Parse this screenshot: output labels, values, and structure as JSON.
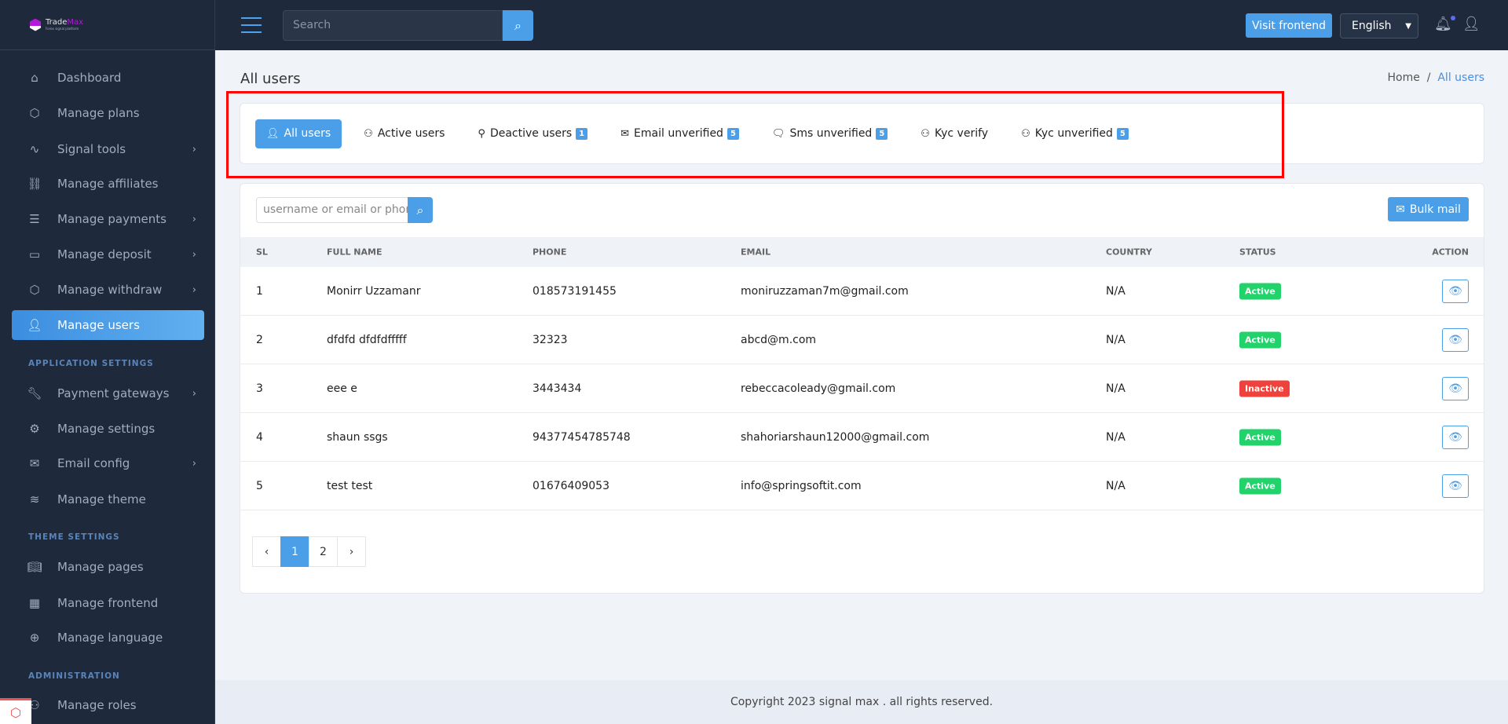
{
  "brand": {
    "name_a": "Trade",
    "name_b": "Max",
    "tagline": "Forex signal platform",
    "accent": "#b01ad8"
  },
  "topbar": {
    "search_placeholder": "Search",
    "visit_label": "Visit frontend",
    "language": "English"
  },
  "sidebar": {
    "items": [
      {
        "label": "Dashboard",
        "icon": "home-icon",
        "chevron": false
      },
      {
        "label": "Manage plans",
        "icon": "box-icon",
        "chevron": false
      },
      {
        "label": "Signal tools",
        "icon": "activity-icon",
        "chevron": true
      },
      {
        "label": "Manage affiliates",
        "icon": "link-icon",
        "chevron": false
      },
      {
        "label": "Manage payments",
        "icon": "list-icon",
        "chevron": true
      },
      {
        "label": "Manage deposit",
        "icon": "credit-card-icon",
        "chevron": true
      },
      {
        "label": "Manage withdraw",
        "icon": "box-icon",
        "chevron": true
      },
      {
        "label": "Manage users",
        "icon": "user-icon",
        "chevron": false,
        "active": true
      },
      {
        "label": "Payment gateways",
        "icon": "wrench-icon",
        "chevron": true
      },
      {
        "label": "Manage settings",
        "icon": "gear-icon",
        "chevron": false
      },
      {
        "label": "Email config",
        "icon": "mail-icon",
        "chevron": true
      },
      {
        "label": "Manage theme",
        "icon": "layers-icon",
        "chevron": false
      },
      {
        "label": "Manage pages",
        "icon": "book-icon",
        "chevron": false
      },
      {
        "label": "Manage frontend",
        "icon": "layout-icon",
        "chevron": false
      },
      {
        "label": "Manage language",
        "icon": "globe-icon",
        "chevron": false
      },
      {
        "label": "Manage roles",
        "icon": "users-icon",
        "chevron": false
      }
    ],
    "sections": [
      "APPLICATION SETTINGS",
      "THEME SETTINGS",
      "ADMINISTRATION"
    ]
  },
  "page": {
    "title": "All users",
    "breadcrumb": [
      "Home",
      "All users"
    ]
  },
  "tabs": [
    {
      "label": "All users",
      "badge": null,
      "active": true
    },
    {
      "label": "Active users",
      "badge": null
    },
    {
      "label": "Deactive users",
      "badge": "1"
    },
    {
      "label": "Email unverified",
      "badge": "5"
    },
    {
      "label": "Sms unverified",
      "badge": "5"
    },
    {
      "label": "Kyc verify",
      "badge": null
    },
    {
      "label": "Kyc unverified",
      "badge": "5"
    }
  ],
  "table": {
    "search_placeholder": "username or email or phone",
    "bulk_label": "Bulk mail",
    "columns": [
      "SL",
      "FULL NAME",
      "PHONE",
      "EMAIL",
      "COUNTRY",
      "STATUS",
      "ACTION"
    ],
    "rows": [
      {
        "sl": "1",
        "name": "Monirr Uzzamanr",
        "phone": "018573191455",
        "email": "moniruzzaman7m@gmail.com",
        "country": "N/A",
        "status": "Active"
      },
      {
        "sl": "2",
        "name": "dfdfd dfdfdfffff",
        "phone": "32323",
        "email": "abcd@m.com",
        "country": "N/A",
        "status": "Active"
      },
      {
        "sl": "3",
        "name": "eee e",
        "phone": "3443434",
        "email": "rebeccacoleady@gmail.com",
        "country": "N/A",
        "status": "Inactive"
      },
      {
        "sl": "4",
        "name": "shaun ssgs",
        "phone": "94377454785748",
        "email": "shahoriarshaun12000@gmail.com",
        "country": "N/A",
        "status": "Active"
      },
      {
        "sl": "5",
        "name": "test test",
        "phone": "01676409053",
        "email": "info@springsoftit.com",
        "country": "N/A",
        "status": "Active"
      }
    ],
    "status_colors": {
      "Active": "#22d36b",
      "Inactive": "#f0423c"
    }
  },
  "pagination": {
    "prev": "‹",
    "pages": [
      "1",
      "2"
    ],
    "current": "1",
    "next": "›"
  },
  "footer": {
    "text": "Copyright 2023 signal max . all rights reserved."
  }
}
